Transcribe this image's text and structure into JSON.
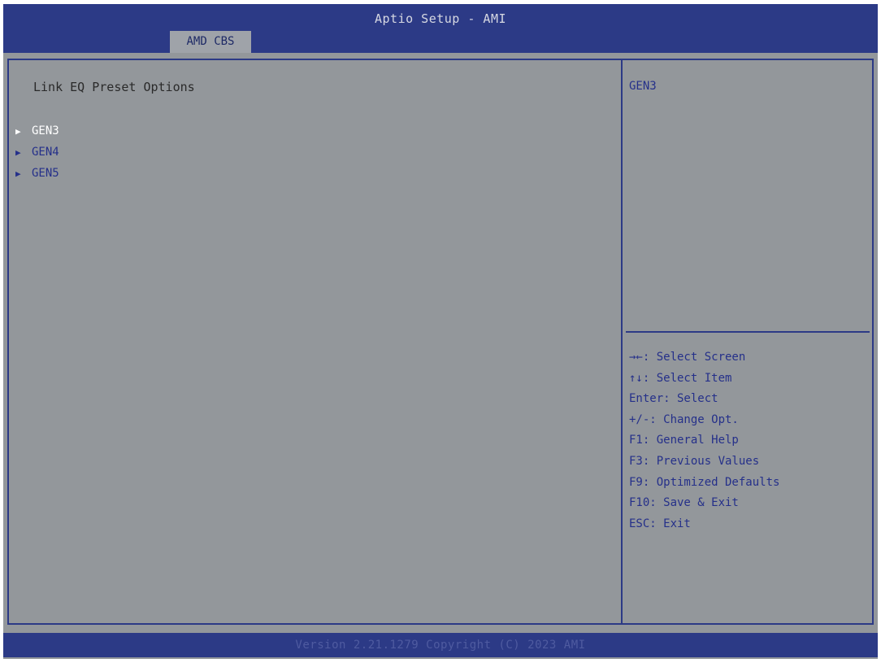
{
  "header": {
    "title": "Aptio Setup - AMI",
    "active_tab": "AMD CBS"
  },
  "main": {
    "heading": "Link EQ Preset Options",
    "items": [
      {
        "label": "GEN3",
        "arrow": "▶"
      },
      {
        "label": "GEN4",
        "arrow": "▶"
      },
      {
        "label": "GEN5",
        "arrow": "▶"
      }
    ]
  },
  "help": {
    "text": "GEN3",
    "keys": [
      "→←: Select Screen",
      "↑↓: Select Item",
      "Enter: Select",
      "+/-: Change Opt.",
      "F1: General Help",
      "F3: Previous Values",
      "F9: Optimized Defaults",
      "F10: Save & Exit",
      "ESC: Exit"
    ]
  },
  "footer": {
    "version": "Version 2.21.1279 Copyright (C) 2023 AMI"
  },
  "colors": {
    "header_bar": "#2c3a86",
    "background": "#93979b",
    "text_blue": "#25308a",
    "selected": "#ffffff"
  }
}
